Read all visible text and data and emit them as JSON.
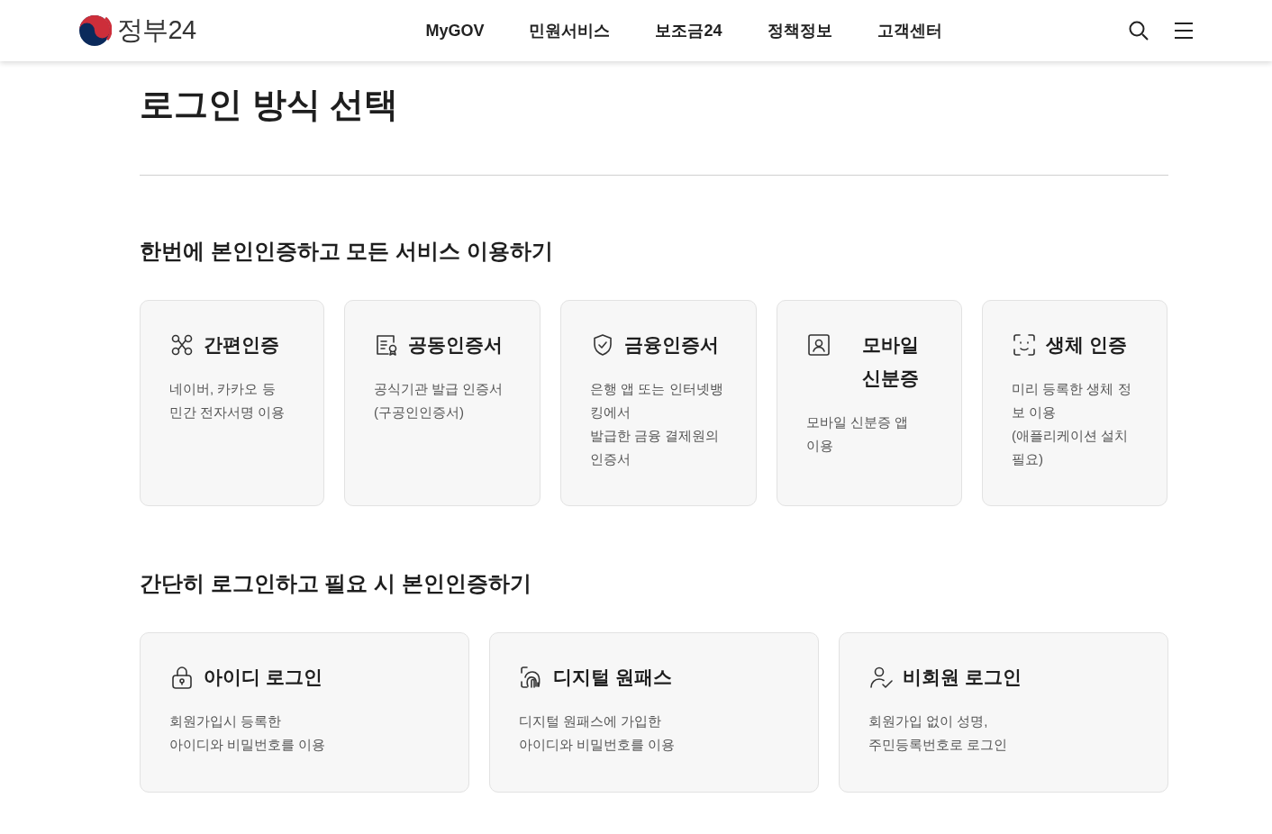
{
  "header": {
    "logo": "정부24",
    "nav": [
      "MyGOV",
      "민원서비스",
      "보조금24",
      "정책정보",
      "고객센터"
    ]
  },
  "page_title": "로그인 방식 선택",
  "sections": [
    {
      "heading": "한번에 본인인증하고 모든 서비스 이용하기",
      "cards": [
        {
          "kind": "simple",
          "title": "간편인증",
          "description": "네이버, 카카오 등\n민간 전자서명 이용"
        },
        {
          "kind": "certificate",
          "title": "공동인증서",
          "description": "공식기관 발급 인증서\n(구공인인증서)"
        },
        {
          "kind": "finance",
          "title": "금융인증서",
          "description": "은행 앱 또는 인터넷뱅\n킹에서\n발급한 금융 결제원의\n인증서"
        },
        {
          "kind": "mobile",
          "title": "모바일 신분증",
          "description": "모바일 신분증 앱\n이용"
        },
        {
          "kind": "bio",
          "title": "생체 인증",
          "description": "미리 등록한 생체 정\n보 이용\n(애플리케이션 설치\n필요)"
        }
      ]
    },
    {
      "heading": "간단히 로그인하고 필요 시 본인인증하기",
      "cards": [
        {
          "kind": "id",
          "title": "아이디 로그인",
          "description": "회원가입시 등록한\n아이디와 비밀번호를 이용"
        },
        {
          "kind": "onepass",
          "title": "디지털 원패스",
          "description": "디지털 원패스에 가입한\n아이디와 비밀번호를 이용"
        },
        {
          "kind": "guest",
          "title": "비회원 로그인",
          "description": "회원가입 없이 성명,\n주민등록번호로 로그인"
        }
      ]
    }
  ]
}
